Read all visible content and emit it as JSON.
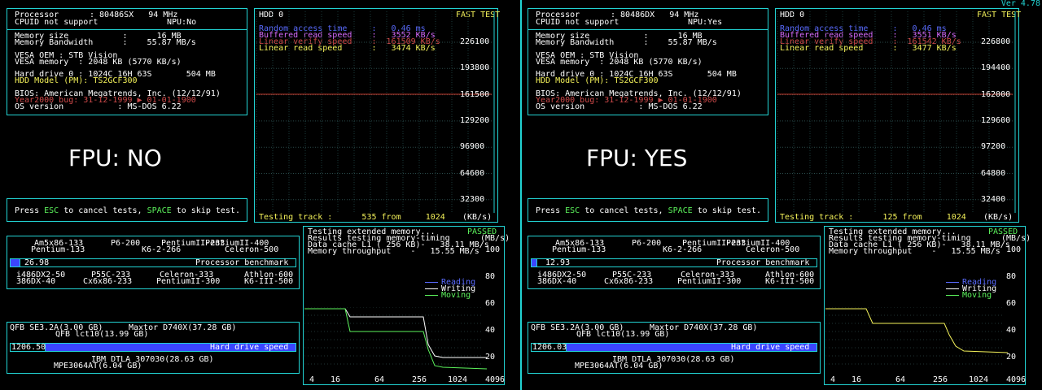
{
  "version": "Ver 4.78",
  "panels": [
    {
      "id": "left",
      "processor_label": "Processor",
      "processor_value": ": 80486SX   94 MHz",
      "cpuid": "CPUID not support",
      "npu": "NPU:No",
      "memory_size": "Memory size           :      16 MB",
      "memory_bw": "Memory Bandwidth      :    55.87 MB/s",
      "vesa_oem": "VESA OEM : STB Vision",
      "vesa_mem": "VESA memory  : 2048 KB (5770 KB/s)",
      "hdd0": "Hard drive 0 : 1024C 16H 63S       504 MB",
      "hdd_model": "HDD Model (PM): TS2GCF300",
      "bios": "BIOS: American Megatrends, Inc. (12/12/91)",
      "y2k": "Year2000 bug: 31-12-1999 ▶ 01-01-1900",
      "os": "OS version           : MS-DOS 6.22",
      "fpu_label": "FPU: NO",
      "press_esc": "Press ",
      "esc": "ESC",
      "to_cancel": " to cancel tests, ",
      "space": "SPACE",
      "to_skip": " to skip test.",
      "hdd_title": "HDD 0",
      "fast_test": "FAST TEST",
      "rand_access": "Random access time     :   0.46 ms",
      "buffered": "Buffered read speed    :   3552 KB/s",
      "linear_verify": "Linear verify speed    :  161509 KB/s",
      "linear_read": "Linear read speed      :   3474 KB/s",
      "hdd_ticks": [
        "226100",
        "193800",
        "161500",
        "129200",
        "96900",
        "64600",
        "32300"
      ],
      "testing_track": "Testing track :      535 from     1024",
      "kbs": "(KB/s)",
      "proc_score": "26.98",
      "proc_label": "Processor benchmark",
      "hdd_score": "1206.50",
      "hdd_label": "Hard drive speed",
      "mem_test": "Testing extended memory...",
      "mem_results": "Results testing memory-timing",
      "cache_l1": "Data cache L1 ( 256 KB)-   38.11 MB/s",
      "mem_tp": "Memory throughput    -   15.55 MB/s",
      "passed": "PASSED",
      "mbs": "(MB/s)",
      "mem_trace_type": "moving"
    },
    {
      "id": "right",
      "processor_label": "Processor",
      "processor_value": ": 80486DX   94 MHz",
      "cpuid": "CPUID not support",
      "npu": "NPU:Yes",
      "memory_size": "Memory size           :      16 MB",
      "memory_bw": "Memory Bandwidth      :    55.87 MB/s",
      "vesa_oem": "VESA OEM : STB Vision",
      "vesa_mem": "VESA memory  : 2048 KB (5770 KB/s)",
      "hdd0": "Hard drive 0 : 1024C 16H 63S       504 MB",
      "hdd_model": "HDD Model (PM): TS2GCF300",
      "bios": "BIOS: American Megatrends, Inc. (12/12/91)",
      "y2k": "Year2000 bug: 31-12-1999 ▶ 01-01-1900",
      "os": "OS version           : MS-DOS 6.22",
      "fpu_label": "FPU: YES",
      "press_esc": "Press ",
      "esc": "ESC",
      "to_cancel": " to cancel tests, ",
      "space": "SPACE",
      "to_skip": " to skip test.",
      "hdd_title": "HDD 0",
      "fast_test": "FAST TEST",
      "rand_access": "Random access time     :   0.46 ms",
      "buffered": "Buffered read speed    :   3551 KB/s",
      "linear_verify": "Linear verify speed    :  161542 KB/s",
      "linear_read": "Linear read speed      :   3477 KB/s",
      "hdd_ticks": [
        "226800",
        "194400",
        "162000",
        "129600",
        "97200",
        "64800",
        "32400"
      ],
      "testing_track": "Testing track :      125 from     1024",
      "kbs": "(KB/s)",
      "proc_score": "12.93",
      "proc_label": "Processor benchmark",
      "hdd_score": "1206.03",
      "hdd_label": "Hard drive speed",
      "mem_test": "Testing extended memory...",
      "mem_results": "Results testing memory-timing",
      "cache_l1": "Data cache L1 ( 256 KB)-   38.11 MB/s",
      "mem_tp": "Memory throughput    -   15.55 MB/s",
      "passed": "PASSED",
      "mbs": "(MB/s)",
      "mem_trace_type": "reading"
    }
  ],
  "proc_refs_top": [
    "Am5x86-133",
    "P6-200",
    "PentiumII-233",
    "PentiumII-400",
    "Pentium-133",
    "K6-2-266",
    "Celeron-500"
  ],
  "proc_refs_bottom": [
    "i486DX2-50",
    "P55C-233",
    "Celeron-333",
    "Athlon-600",
    "386DX-40",
    "Cx6x86-233",
    "PentiumII-300",
    "K6-III-500"
  ],
  "hdd_refs_top": [
    "QFB SE3.2A(3.00 GB)",
    "Maxtor D740X(37.28 GB)",
    "QFB lct10(13.99 GB)"
  ],
  "hdd_refs_bottom": [
    "IBM DTLA 307030(28.63 GB)",
    "MPE3064AT(6.04 GB)"
  ],
  "legend": [
    "Reading",
    "Writing",
    "Moving"
  ],
  "mem_x_ticks": [
    "4",
    "16",
    "64",
    "256",
    "1024",
    "4096"
  ],
  "mem_y_ticks": [
    "100",
    "80",
    "60",
    "40",
    "20"
  ],
  "colors": {
    "frame": "#22d3d3",
    "reading": "#5a6bff",
    "writing": "#ffffff",
    "moving": "#5cf35c",
    "trace_red": "#c0392b",
    "bar": "#3b45ff"
  }
}
